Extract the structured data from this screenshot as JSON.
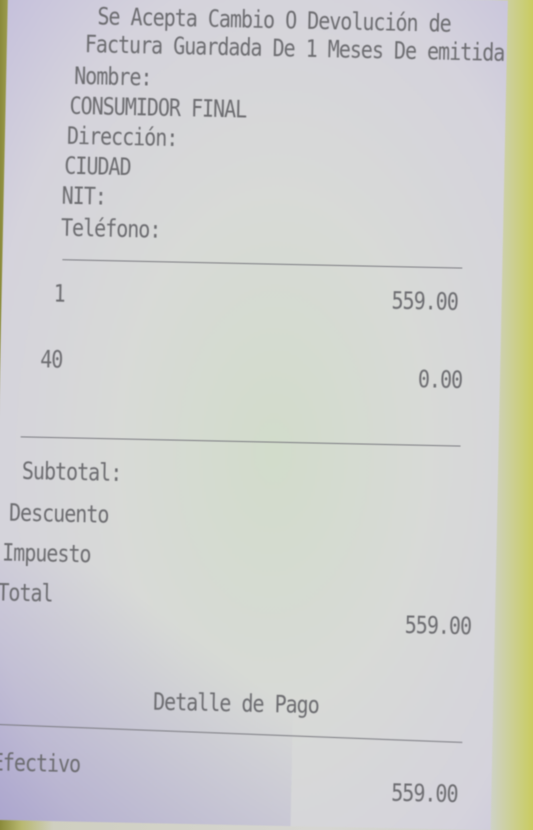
{
  "header": {
    "line1": "Se Acepta Cambio O Devolución de",
    "line2": "Factura Guardada De 1 Meses De emitida"
  },
  "customer": {
    "name_label": "Nombre:",
    "name_value": "CONSUMIDOR FINAL",
    "address_label": "Dirección:",
    "city": "CIUDAD",
    "nit_label": "NIT:",
    "phone_label": "Teléfono:"
  },
  "items": [
    {
      "qty": "1",
      "amount": "559.00"
    },
    {
      "qty": "40",
      "amount": "0.00"
    }
  ],
  "totals": {
    "subtotal_label": "Subtotal:",
    "discount_label": "Descuento",
    "tax_label": "Impuesto",
    "total_label": "Total",
    "total_value": "559.00"
  },
  "payment": {
    "title": "Detalle de Pago",
    "method": "Efectivo",
    "amount": "559.00"
  }
}
